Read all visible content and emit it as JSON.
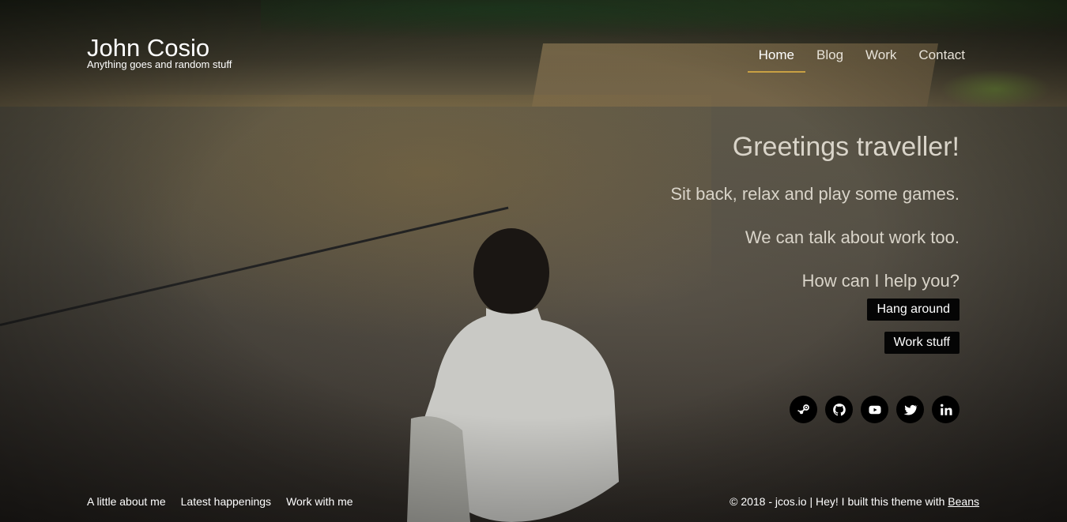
{
  "brand": {
    "name": "John Cosio",
    "tagline": "Anything goes and random stuff"
  },
  "nav": {
    "items": [
      {
        "label": "Home",
        "active": true
      },
      {
        "label": "Blog",
        "active": false
      },
      {
        "label": "Work",
        "active": false
      },
      {
        "label": "Contact",
        "active": false
      }
    ]
  },
  "hero": {
    "title": "Greetings traveller!",
    "lines": [
      "Sit back, relax and play some games.",
      "We can talk about work too.",
      "How can I help you?"
    ],
    "buttons": {
      "hang_around": "Hang around",
      "work_stuff": "Work stuff"
    }
  },
  "socials": [
    {
      "icon": "steam-icon"
    },
    {
      "icon": "github-icon"
    },
    {
      "icon": "youtube-icon"
    },
    {
      "icon": "twitter-icon"
    },
    {
      "icon": "linkedin-icon"
    }
  ],
  "footer": {
    "links": [
      "A little about me",
      "Latest happenings",
      "Work with me"
    ],
    "copyright_text": "© 2018 - jcos.io | Hey! I built this theme with ",
    "copyright_link": "Beans"
  },
  "colors": {
    "accent": "#c8a043",
    "button_bg": "#050505",
    "text": "#ffffff"
  }
}
